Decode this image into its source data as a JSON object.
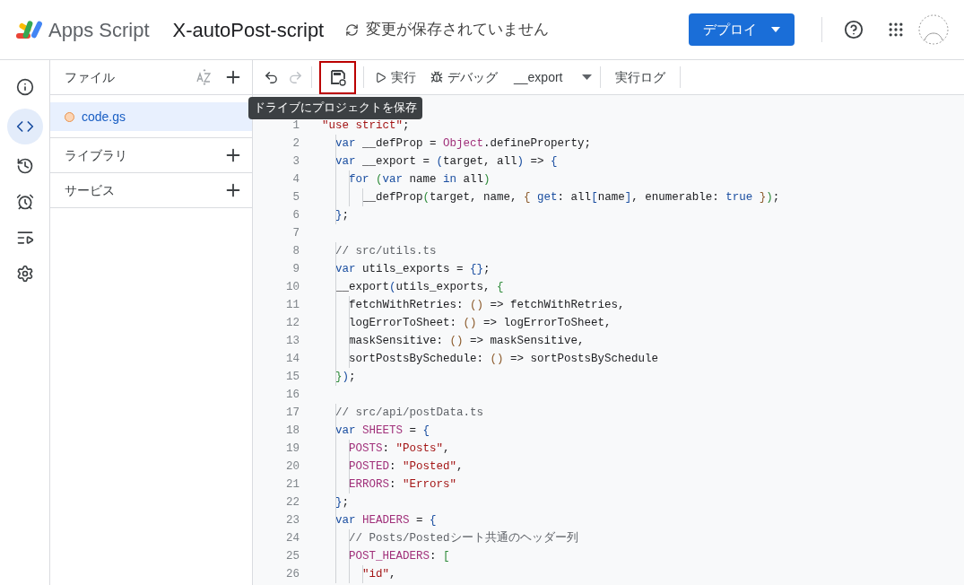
{
  "header": {
    "product": "Apps Script",
    "project_title": "X-autoPost-script",
    "save_status": "変更が保存されていません",
    "deploy_button": "デプロイ"
  },
  "rail": [
    {
      "selected": false
    },
    {
      "selected": true
    },
    {
      "selected": false
    },
    {
      "selected": false
    },
    {
      "selected": false
    },
    {
      "selected": false
    }
  ],
  "files_panel": {
    "title": "ファイル",
    "files": [
      {
        "name": "code.gs",
        "selected": true
      }
    ],
    "sections": [
      {
        "title": "ライブラリ"
      },
      {
        "title": "サービス"
      }
    ]
  },
  "toolbar": {
    "undo_disabled": false,
    "redo_disabled": true,
    "save_highlighted": true,
    "run": "実行",
    "debug": "デバッグ",
    "function": "__export",
    "log": "実行ログ",
    "tooltip": "ドライブにプロジェクトを保存"
  },
  "code_lines": [
    {
      "number": "1",
      "tokens": [
        {
          "kind": "str",
          "text": "\"use strict\""
        },
        {
          "kind": "plain",
          "text": ";"
        }
      ]
    },
    {
      "number": "2",
      "tokens": [
        {
          "kind": "kw",
          "text": "  var"
        },
        {
          "kind": "plain",
          "text": " __defProp = "
        },
        {
          "kind": "obj",
          "text": "Object"
        },
        {
          "kind": "plain",
          "text": ".defineProperty;"
        }
      ]
    },
    {
      "number": "3",
      "tokens": [
        {
          "kind": "kw",
          "text": "  var"
        },
        {
          "kind": "plain",
          "text": " __export = "
        },
        {
          "kind": "b1",
          "text": "("
        },
        {
          "kind": "plain",
          "text": "target, all"
        },
        {
          "kind": "b1",
          "text": ")"
        },
        {
          "kind": "plain",
          "text": " => "
        },
        {
          "kind": "b1",
          "text": "{"
        }
      ]
    },
    {
      "number": "4",
      "tokens": [
        {
          "kind": "kw",
          "text": "    for"
        },
        {
          "kind": "b2",
          "text": " ("
        },
        {
          "kind": "kw",
          "text": "var"
        },
        {
          "kind": "plain",
          "text": " name "
        },
        {
          "kind": "kw",
          "text": "in"
        },
        {
          "kind": "plain",
          "text": " all"
        },
        {
          "kind": "b2",
          "text": ")"
        }
      ]
    },
    {
      "number": "5",
      "tokens": [
        {
          "kind": "plain",
          "text": "      __defProp"
        },
        {
          "kind": "b2",
          "text": "("
        },
        {
          "kind": "plain",
          "text": "target, name, "
        },
        {
          "kind": "b3",
          "text": "{ "
        },
        {
          "kind": "kw",
          "text": "get"
        },
        {
          "kind": "plain",
          "text": ": all"
        },
        {
          "kind": "b1",
          "text": "["
        },
        {
          "kind": "plain",
          "text": "name"
        },
        {
          "kind": "b1",
          "text": "]"
        },
        {
          "kind": "plain",
          "text": ", enumerable: "
        },
        {
          "kind": "kw",
          "text": "true"
        },
        {
          "kind": "b3",
          "text": " }"
        },
        {
          "kind": "b2",
          "text": ")"
        },
        {
          "kind": "plain",
          "text": ";"
        }
      ]
    },
    {
      "number": "6",
      "tokens": [
        {
          "kind": "b1",
          "text": "  }"
        },
        {
          "kind": "plain",
          "text": ";"
        }
      ]
    },
    {
      "number": "7"
    },
    {
      "number": "8",
      "tokens": [
        {
          "kind": "comment",
          "text": "  // src/utils.ts"
        }
      ]
    },
    {
      "number": "9",
      "tokens": [
        {
          "kind": "kw",
          "text": "  var"
        },
        {
          "kind": "plain",
          "text": " utils_exports = "
        },
        {
          "kind": "b1",
          "text": "{}"
        },
        {
          "kind": "plain",
          "text": ";"
        }
      ]
    },
    {
      "number": "10",
      "tokens": [
        {
          "kind": "plain",
          "text": "  __export"
        },
        {
          "kind": "b1",
          "text": "("
        },
        {
          "kind": "plain",
          "text": "utils_exports, "
        },
        {
          "kind": "b2",
          "text": "{"
        }
      ]
    },
    {
      "number": "11",
      "tokens": [
        {
          "kind": "plain",
          "text": "    fetchWithRetries: "
        },
        {
          "kind": "b3",
          "text": "()"
        },
        {
          "kind": "plain",
          "text": " => fetchWithRetries,"
        }
      ]
    },
    {
      "number": "12",
      "tokens": [
        {
          "kind": "plain",
          "text": "    logErrorToSheet: "
        },
        {
          "kind": "b3",
          "text": "()"
        },
        {
          "kind": "plain",
          "text": " => logErrorToSheet,"
        }
      ]
    },
    {
      "number": "13",
      "tokens": [
        {
          "kind": "plain",
          "text": "    maskSensitive: "
        },
        {
          "kind": "b3",
          "text": "()"
        },
        {
          "kind": "plain",
          "text": " => maskSensitive,"
        }
      ]
    },
    {
      "number": "14",
      "tokens": [
        {
          "kind": "plain",
          "text": "    sortPostsBySchedule: "
        },
        {
          "kind": "b3",
          "text": "()"
        },
        {
          "kind": "plain",
          "text": " => sortPostsBySchedule"
        }
      ]
    },
    {
      "number": "15",
      "tokens": [
        {
          "kind": "b2",
          "text": "  }"
        },
        {
          "kind": "b1",
          "text": ")"
        },
        {
          "kind": "plain",
          "text": ";"
        }
      ]
    },
    {
      "number": "16"
    },
    {
      "number": "17",
      "tokens": [
        {
          "kind": "comment",
          "text": "  // src/api/postData.ts"
        }
      ]
    },
    {
      "number": "18",
      "tokens": [
        {
          "kind": "kw",
          "text": "  var"
        },
        {
          "kind": "obj",
          "text": " SHEETS"
        },
        {
          "kind": "plain",
          "text": " = "
        },
        {
          "kind": "b1",
          "text": "{"
        }
      ]
    },
    {
      "number": "19",
      "tokens": [
        {
          "kind": "obj",
          "text": "    POSTS"
        },
        {
          "kind": "plain",
          "text": ": "
        },
        {
          "kind": "str",
          "text": "\"Posts\""
        },
        {
          "kind": "plain",
          "text": ","
        }
      ]
    },
    {
      "number": "20",
      "tokens": [
        {
          "kind": "obj",
          "text": "    POSTED"
        },
        {
          "kind": "plain",
          "text": ": "
        },
        {
          "kind": "str",
          "text": "\"Posted\""
        },
        {
          "kind": "plain",
          "text": ","
        }
      ]
    },
    {
      "number": "21",
      "tokens": [
        {
          "kind": "obj",
          "text": "    ERRORS"
        },
        {
          "kind": "plain",
          "text": ": "
        },
        {
          "kind": "str",
          "text": "\"Errors\""
        }
      ]
    },
    {
      "number": "22",
      "tokens": [
        {
          "kind": "b1",
          "text": "  }"
        },
        {
          "kind": "plain",
          "text": ";"
        }
      ]
    },
    {
      "number": "23",
      "tokens": [
        {
          "kind": "kw",
          "text": "  var"
        },
        {
          "kind": "obj",
          "text": " HEADERS"
        },
        {
          "kind": "plain",
          "text": " = "
        },
        {
          "kind": "b1",
          "text": "{"
        }
      ]
    },
    {
      "number": "24",
      "tokens": [
        {
          "kind": "comment",
          "text": "    // Posts/Postedシート共通のヘッダー列"
        }
      ]
    },
    {
      "number": "25",
      "tokens": [
        {
          "kind": "obj",
          "text": "    POST_HEADERS"
        },
        {
          "kind": "plain",
          "text": ": "
        },
        {
          "kind": "b2",
          "text": "["
        }
      ]
    },
    {
      "number": "26",
      "tokens": [
        {
          "kind": "str",
          "text": "      \"id\""
        },
        {
          "kind": "plain",
          "text": ","
        }
      ]
    }
  ]
}
